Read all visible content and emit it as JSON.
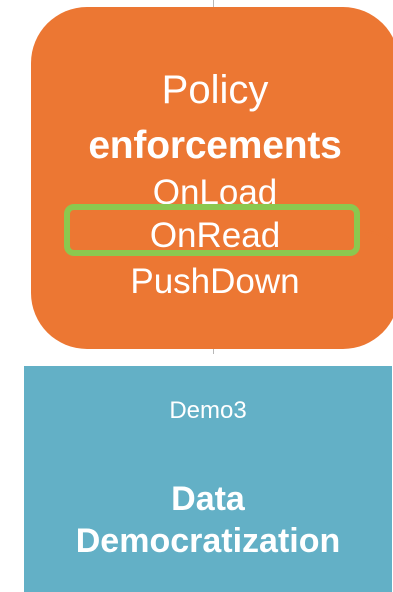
{
  "colors": {
    "policy_card": "#ec7733",
    "highlight": "#8bc84f",
    "demo_card": "#63b0c6",
    "arrow": "#ec7733"
  },
  "policy": {
    "title": "Policy",
    "subtitle": "enforcements",
    "items": [
      "OnLoad",
      "OnRead",
      "PushDown"
    ],
    "highlighted_item": "OnRead"
  },
  "demo": {
    "label": "Demo3",
    "title_line1": "Data",
    "title_line2": "Democratization"
  }
}
